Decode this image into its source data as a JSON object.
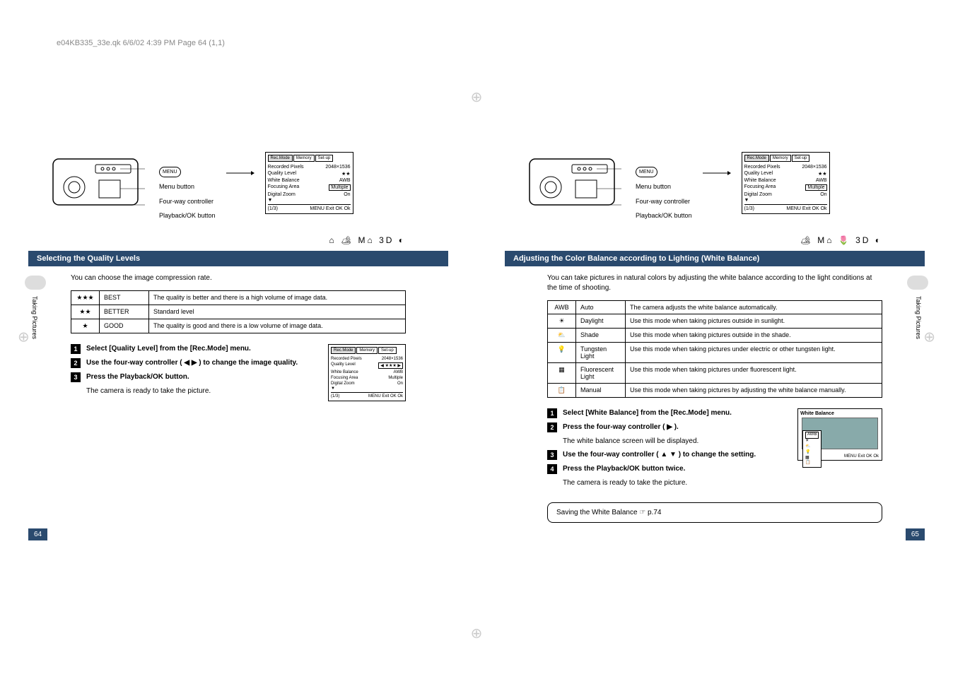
{
  "header": "e04KB335_33e.qk  6/6/02  4:39 PM  Page 64  (1,1)",
  "camera_labels": {
    "menu_btn": "Menu button",
    "menu_pill": "MENU",
    "fourway": "Four-way controller",
    "playback": "Playback/OK button"
  },
  "menu_screen": {
    "tabs": [
      "Rec.Mode",
      "Memory",
      "Set-up"
    ],
    "rows": [
      {
        "label": "Recorded Pixels",
        "value": "2048×1536"
      },
      {
        "label": "Quality Level",
        "value": "★★"
      },
      {
        "label": "White Balance",
        "value": "AWB"
      },
      {
        "label": "Focusing Area",
        "value": "Multiple"
      },
      {
        "label": "Digital Zoom",
        "value": "On"
      }
    ],
    "footer_page": "(1/3)",
    "footer_actions": "MENU Exit  OK Ok"
  },
  "menu_screen_quality": {
    "rows": [
      {
        "label": "Recorded Pixels",
        "value": "2048×1536"
      },
      {
        "label": "Quality Level",
        "value": "★★★"
      },
      {
        "label": "White Balance",
        "value": "AWB"
      },
      {
        "label": "Focusing Area",
        "value": "Multiple"
      },
      {
        "label": "Digital Zoom",
        "value": "On"
      }
    ]
  },
  "left_page": {
    "icons": "⌂ 🏕 M⌂ 3D ◐",
    "title": "Selecting the Quality Levels",
    "intro": "You can choose the image compression rate.",
    "table": [
      {
        "rating": "★★★",
        "name": "BEST",
        "desc": "The quality is better and there is a high volume of image data."
      },
      {
        "rating": "★★",
        "name": "BETTER",
        "desc": "Standard level"
      },
      {
        "rating": "★",
        "name": "GOOD",
        "desc": "The quality is good and there is a low volume of image data."
      }
    ],
    "steps": [
      {
        "bold": "Select [Quality Level] from the [Rec.Mode] menu.",
        "sub": ""
      },
      {
        "bold": "Use the four-way controller ( ◀ ▶ ) to change the image quality.",
        "sub": ""
      },
      {
        "bold": "Press the Playback/OK button.",
        "sub": "The camera is ready to take the picture."
      }
    ],
    "side_tab": "Taking Pictures",
    "page_num": "64"
  },
  "right_page": {
    "icons": "🏕 M⌂ 🌷 3D ◐",
    "title": "Adjusting the Color Balance according to Lighting (White Balance)",
    "intro": "You can take pictures in natural colors by adjusting the white balance according to the light conditions at the time of shooting.",
    "table": [
      {
        "icon": "AWB",
        "name": "Auto",
        "desc": "The camera adjusts the white balance automatically."
      },
      {
        "icon": "☀",
        "name": "Daylight",
        "desc": "Use this mode when taking pictures outside in sunlight."
      },
      {
        "icon": "⛅",
        "name": "Shade",
        "desc": "Use this mode when taking pictures outside in the shade."
      },
      {
        "icon": "💡",
        "name": "Tungsten Light",
        "desc": "Use this mode when taking pictures under electric or other tungsten light."
      },
      {
        "icon": "▦",
        "name": "Fluorescent Light",
        "desc": "Use this mode when taking pictures under fluorescent light."
      },
      {
        "icon": "📋",
        "name": "Manual",
        "desc": "Use this mode when taking pictures by adjusting the white balance manually."
      }
    ],
    "steps": [
      {
        "bold": "Select [White Balance] from the [Rec.Mode] menu.",
        "sub": ""
      },
      {
        "bold": "Press the four-way controller ( ▶ ).",
        "sub": "The white balance screen will be displayed."
      },
      {
        "bold": "Use the four-way controller ( ▲ ▼ ) to change the setting.",
        "sub": ""
      },
      {
        "bold": "Press the Playback/OK button twice.",
        "sub": "The camera is ready to take the picture."
      }
    ],
    "saving_note": "Saving the White Balance ☞ p.74",
    "wb_screen_title": "White Balance",
    "wb_screen_selected": "AWB",
    "wb_screen_footer": "MENU Exit  OK Ok",
    "side_tab": "Taking Pictures",
    "page_num": "65"
  }
}
